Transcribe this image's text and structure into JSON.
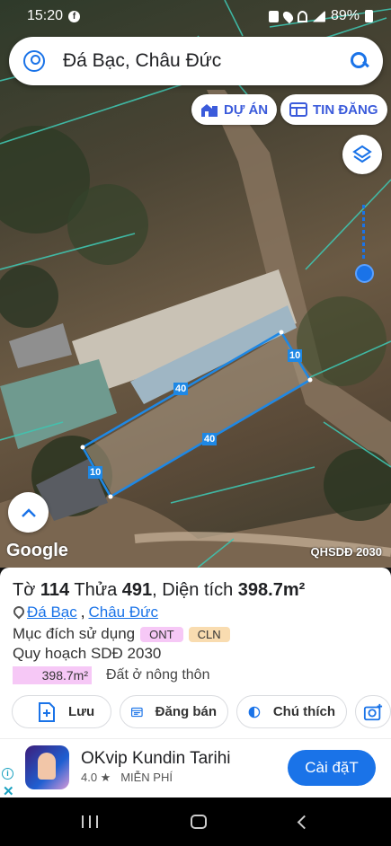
{
  "status_bar": {
    "time": "15:20",
    "battery": "89%"
  },
  "search": {
    "query": "Đá Bạc, Châu Đức"
  },
  "chips": {
    "project": "DỰ ÁN",
    "listing": "TIN ĐĂNG"
  },
  "map": {
    "provider_logo": "Google",
    "overlay_label": "QHSDĐ 2030",
    "dimensions": [
      "10",
      "40",
      "40",
      "10"
    ]
  },
  "parcel": {
    "to_label": "Tờ",
    "to_value": "114",
    "thua_label": "Thửa",
    "thua_value": "491",
    "area_label": "Diện tích",
    "area_value": "398.7m²",
    "location_commune": "Đá Bạc",
    "location_district": "Châu Đức",
    "purpose_label": "Mục đích sử dụng",
    "purpose_tags": [
      "ONT",
      "CLN"
    ],
    "plan_label": "Quy hoạch SDĐ 2030",
    "plan_area": "398.7m²",
    "plan_type": "Đất ở nông thôn"
  },
  "actions": {
    "save": "Lưu",
    "post": "Đăng bán",
    "legend": "Chú thích"
  },
  "ad": {
    "app_name": "OKvip Kundin Tarihi",
    "rating": "4.0 ★",
    "price": "MIỄN PHÍ",
    "install": "Cài đặT"
  },
  "colors": {
    "accent": "#1a73e8",
    "parcel_outline": "#1e88e5",
    "ont_tag": "#f6c8f6",
    "cln_tag": "#f9dcb0"
  }
}
